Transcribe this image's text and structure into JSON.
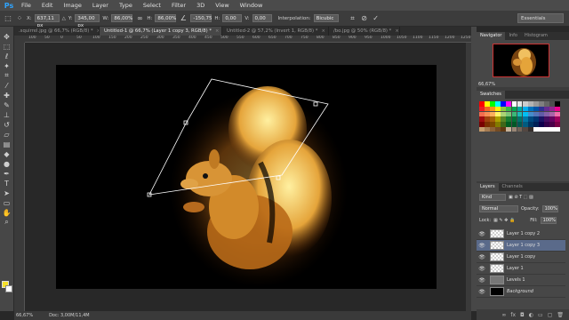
{
  "app": {
    "logo": "Ps"
  },
  "menu": [
    "File",
    "Edit",
    "Image",
    "Layer",
    "Type",
    "Select",
    "Filter",
    "3D",
    "View",
    "Window"
  ],
  "options": {
    "x_label": "X:",
    "x_value": "637,11 px",
    "y_label": "Y:",
    "y_value": "345,00 px",
    "w_label": "W:",
    "w_value": "86,00%",
    "h_label": "H:",
    "h_value": "86,00%",
    "angle_value": "-150,75",
    "hskew_label": "H:",
    "hskew_value": "0,00",
    "vskew_label": "V:",
    "vskew_value": "0,00",
    "interp_label": "Interpolation:",
    "interp_value": "Bicubic",
    "workspace": "Essentials"
  },
  "tabs": [
    {
      "label": ".squirrel.jpg @ 66,7% (RGB/8) *",
      "active": false
    },
    {
      "label": "Untitled-1 @ 66,7% (Layer 1 copy 3, RGB/8) *",
      "active": true
    },
    {
      "label": "Untitled-2 @ 57,2% (Invert 1, RGB/8) *",
      "active": false
    },
    {
      "label": "/bo.jpg @ 50% (RGB/8) *",
      "active": false
    }
  ],
  "ruler_ticks": [
    "100",
    "50",
    "0",
    "50",
    "100",
    "150",
    "200",
    "250",
    "300",
    "350",
    "400",
    "450",
    "500",
    "550",
    "600",
    "650",
    "700",
    "750",
    "800",
    "850",
    "900",
    "950",
    "1000",
    "1050",
    "1100",
    "1150",
    "1200",
    "1250"
  ],
  "status": {
    "zoom": "66,67%",
    "doc": "Doc: 3,00M/11,4M"
  },
  "navigator": {
    "tabs": [
      "Navigator",
      "Info",
      "Histogram"
    ],
    "zoom": "66,67%"
  },
  "swatches": {
    "tab": "Swatches",
    "colors": [
      "#ff0000",
      "#ffff00",
      "#00ff00",
      "#00ffff",
      "#0000ff",
      "#ff00ff",
      "#ffffff",
      "#e6e6e6",
      "#cccccc",
      "#b3b3b3",
      "#999999",
      "#808080",
      "#666666",
      "#4d4d4d",
      "#000000",
      "#ed1c24",
      "#f26522",
      "#f7941d",
      "#fff200",
      "#8dc63f",
      "#39b54a",
      "#00a651",
      "#00a99d",
      "#00aeef",
      "#0072bc",
      "#0054a6",
      "#2e3192",
      "#662d91",
      "#92278f",
      "#ec008c",
      "#f26c4f",
      "#f68e56",
      "#fbaf5d",
      "#fff568",
      "#acd373",
      "#7cc576",
      "#3bb878",
      "#1abbb4",
      "#00bff3",
      "#448ccb",
      "#5574b9",
      "#605ca8",
      "#8560a8",
      "#a864a8",
      "#f06eaa",
      "#9e0b0f",
      "#a0410d",
      "#a36209",
      "#aba000",
      "#598527",
      "#197b30",
      "#007236",
      "#00746b",
      "#0076a3",
      "#004a80",
      "#003471",
      "#1b1464",
      "#440e62",
      "#630460",
      "#9e005d",
      "#790000",
      "#7b2e00",
      "#7d4900",
      "#827b00",
      "#406618",
      "#005e20",
      "#005826",
      "#005952",
      "#005b7f",
      "#003663",
      "#002157",
      "#0d004c",
      "#32004b",
      "#4b0049",
      "#7b0046",
      "#c69c6d",
      "#a67c52",
      "#8c6239",
      "#754c24",
      "#603913",
      "#c7b299",
      "#998675",
      "#736357",
      "#534741",
      "#362f2d",
      "#ffffff",
      "#ffffff",
      "#ffffff",
      "#ffffff",
      "#ffffff"
    ]
  },
  "layers": {
    "tabs": [
      "Layers",
      "Channels"
    ],
    "kind": "Kind",
    "blend_mode": "Normal",
    "opacity_label": "Opacity:",
    "opacity_value": "100%",
    "lock_label": "Lock:",
    "fill_label": "Fill:",
    "fill_value": "100%",
    "items": [
      {
        "name": "Layer 1 copy 2",
        "thumb": "trans",
        "selected": false,
        "italic": false
      },
      {
        "name": "Layer 1 copy 3",
        "thumb": "trans",
        "selected": true,
        "italic": false
      },
      {
        "name": "Layer 1 copy",
        "thumb": "trans",
        "selected": false,
        "italic": false
      },
      {
        "name": "Layer 1",
        "thumb": "trans",
        "selected": false,
        "italic": false
      },
      {
        "name": "Levels 1",
        "thumb": "adj",
        "selected": false,
        "italic": false
      },
      {
        "name": "Background",
        "thumb": "black",
        "selected": false,
        "italic": true
      }
    ]
  },
  "colors": {
    "foreground": "#f5e02a",
    "background": "#ffffff",
    "accent_ps": "#2fa4ff"
  }
}
